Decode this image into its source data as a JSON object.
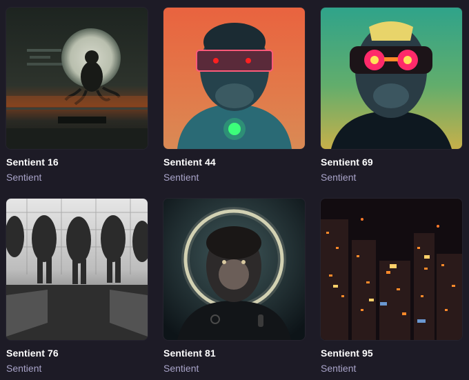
{
  "gallery": {
    "items": [
      {
        "title": "Sentient 16",
        "collection": "Sentient",
        "art": "moon-ape-octopus"
      },
      {
        "title": "Sentient 44",
        "collection": "Sentient",
        "art": "cyber-ape-visor-orange"
      },
      {
        "title": "Sentient 69",
        "collection": "Sentient",
        "art": "cyber-ape-goggles-teal"
      },
      {
        "title": "Sentient 76",
        "collection": "Sentient",
        "art": "ape-soldiers-monochrome"
      },
      {
        "title": "Sentient 81",
        "collection": "Sentient",
        "art": "ape-halo-portrait"
      },
      {
        "title": "Sentient 95",
        "collection": "Sentient",
        "art": "night-city-lights"
      }
    ]
  },
  "colors": {
    "background": "#1d1b26",
    "title": "#ffffff",
    "collection": "#a9a4c9"
  }
}
